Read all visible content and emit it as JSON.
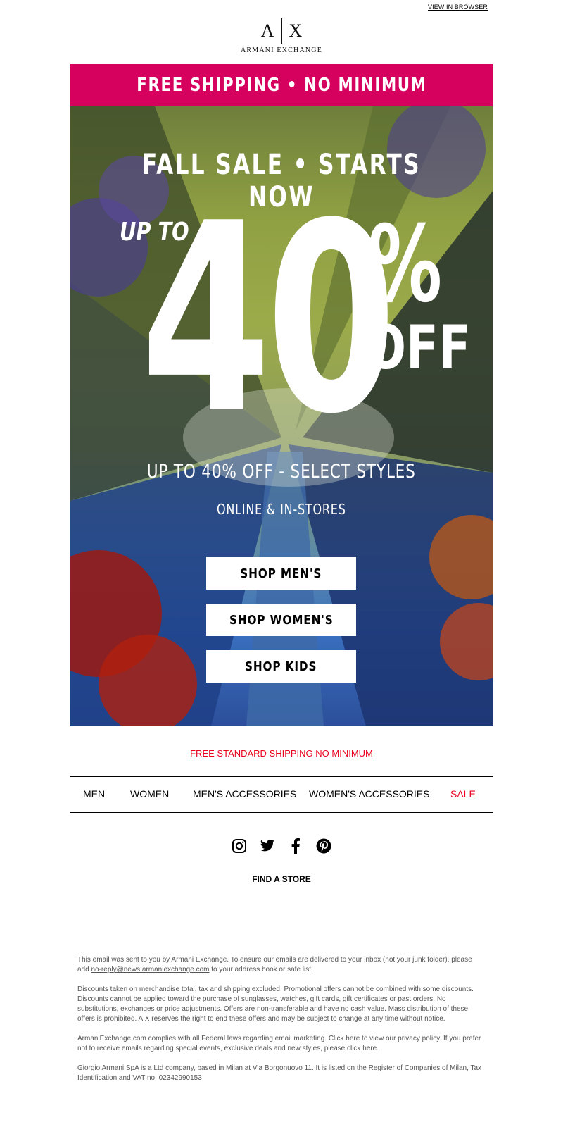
{
  "header": {
    "view_in_browser": "VIEW IN BROWSER",
    "logo_mark_left": "A",
    "logo_mark_right": "X",
    "logo_sub": "ARMANI EXCHANGE"
  },
  "banner": {
    "text": "FREE SHIPPING • NO MINIMUM",
    "color": "#d6005f"
  },
  "hero": {
    "headline": "FALL SALE • STARTS NOW",
    "up_to": "UP TO",
    "big_number": "40",
    "percent": "%",
    "off": "OFF",
    "subline": "UP TO 40% OFF - SELECT STYLES",
    "channel": "ONLINE & IN-STORES",
    "buttons": [
      {
        "label": "SHOP MEN'S"
      },
      {
        "label": "SHOP WOMEN'S"
      },
      {
        "label": "SHOP KIDS"
      }
    ]
  },
  "free_shipping_line": "FREE STANDARD SHIPPING NO MINIMUM",
  "nav": {
    "items": [
      {
        "label": "MEN"
      },
      {
        "label": "WOMEN"
      },
      {
        "label": "MEN'S ACCESSORIES"
      },
      {
        "label": "WOMEN'S ACCESSORIES"
      },
      {
        "label": "SALE"
      }
    ],
    "sale_color": "#e8001c"
  },
  "social": {
    "icons": [
      "instagram-icon",
      "twitter-icon",
      "facebook-icon",
      "pinterest-icon"
    ]
  },
  "find_store": "FIND A STORE",
  "legal": {
    "p1_a": "This email was sent to you by Armani Exchange. To ensure our emails are delivered to your inbox (not your junk folder), please add ",
    "p1_email": "no-reply@news.armaniexchange.com",
    "p1_b": " to your address book or safe list.",
    "p2": "Discounts taken on merchandise total, tax and shipping excluded. Promotional offers cannot be combined with some discounts. Discounts cannot be applied toward the purchase of sunglasses, watches, gift cards, gift certificates or past orders. No substitutions, exchanges or price adjustments. Offers are non-transferable and have no cash value. Mass distribution of these offers is prohibited. A|X reserves the right to end these offers and may be subject to change at any time without notice.",
    "p3": "ArmaniExchange.com complies with all Federal laws regarding email marketing. Click here to view our privacy policy. If you prefer not to receive emails regarding special events, exclusive deals and new styles, please click here.",
    "p4": "Giorgio Armani SpA is a Ltd company, based in Milan at Via Borgonuovo 11. It is listed on the Register of Companies of Milan, Tax Identification and VAT no. 02342990153"
  }
}
